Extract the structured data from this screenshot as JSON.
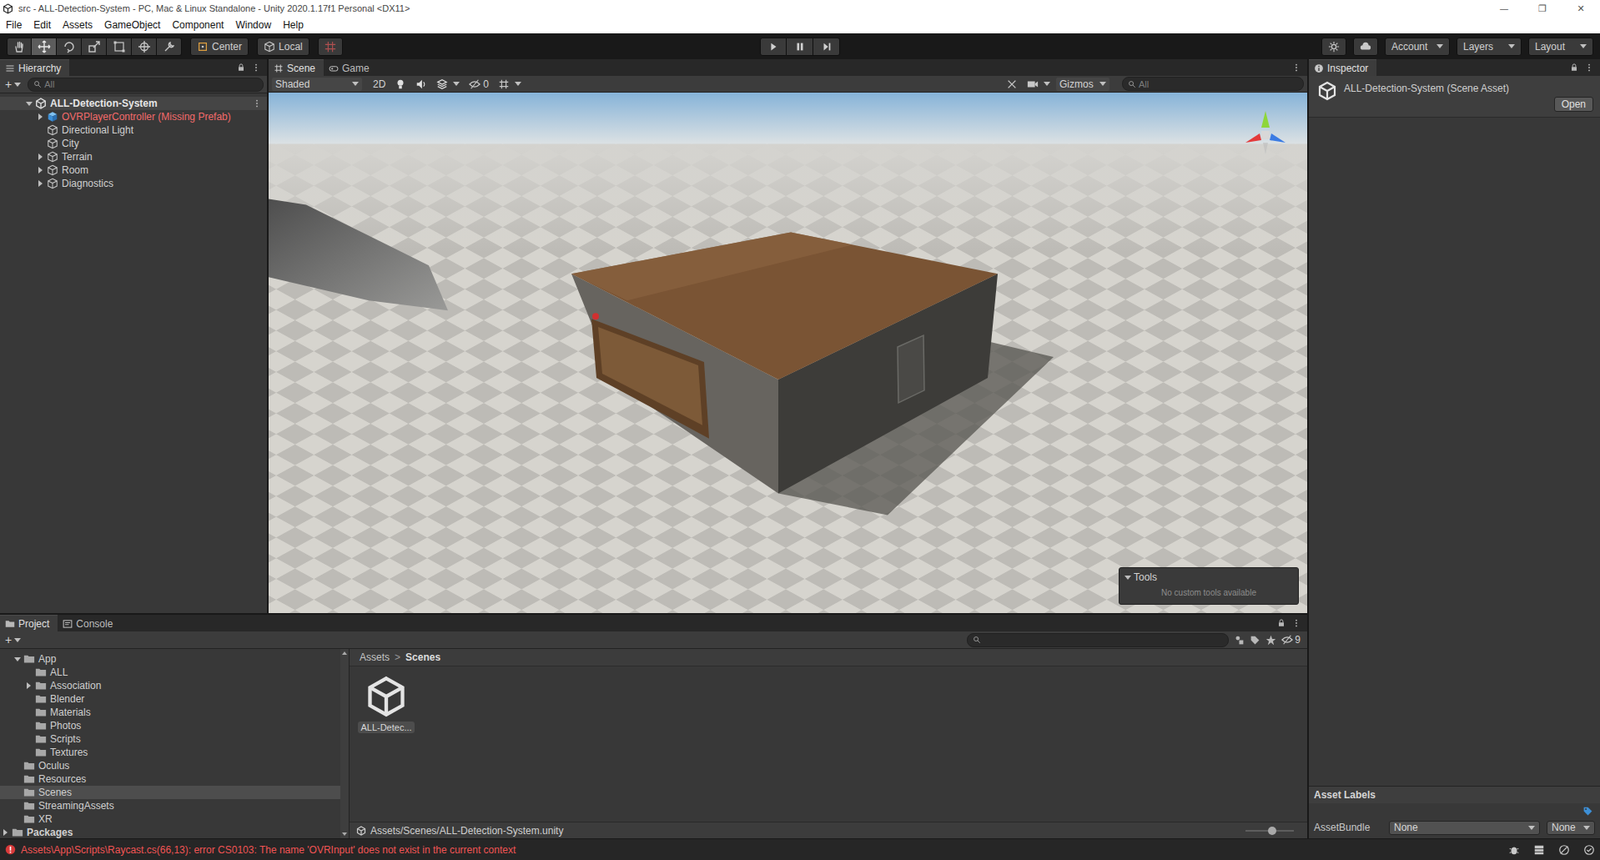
{
  "window": {
    "title": "src - ALL-Detection-System - PC, Mac & Linux Standalone - Unity 2020.1.17f1 Personal <DX11>",
    "controls": [
      "—",
      "❐",
      "✕"
    ]
  },
  "menu": [
    "File",
    "Edit",
    "Assets",
    "GameObject",
    "Component",
    "Window",
    "Help"
  ],
  "toolbar": {
    "tools": [
      {
        "selected": false
      },
      {
        "selected": true
      },
      {
        "selected": false
      },
      {
        "selected": false
      },
      {
        "selected": false
      },
      {
        "selected": false
      },
      {
        "selected": false
      }
    ],
    "pivot": "Center",
    "space": "Local",
    "account": "Account",
    "layers": "Layers",
    "layout": "Layout"
  },
  "hierarchy": {
    "title": "Hierarchy",
    "add": "+",
    "search": {
      "placeholder": "All"
    },
    "scene": {
      "name": "ALL-Detection-System",
      "expanded": true
    },
    "items": [
      {
        "name": "OVRPlayerController (Missing Prefab)",
        "kind": "prefab",
        "expandable": true,
        "expanded": false,
        "missing": true
      },
      {
        "name": "Directional Light",
        "kind": "object",
        "expandable": false,
        "expanded": false,
        "missing": false
      },
      {
        "name": "City",
        "kind": "object",
        "expandable": false,
        "expanded": false,
        "missing": false
      },
      {
        "name": "Terrain",
        "kind": "object",
        "expandable": true,
        "expanded": false,
        "missing": false
      },
      {
        "name": "Room",
        "kind": "object",
        "expandable": true,
        "expanded": false,
        "missing": false
      },
      {
        "name": "Diagnostics",
        "kind": "object",
        "expandable": true,
        "expanded": false,
        "missing": false
      }
    ]
  },
  "scene_view": {
    "tabs": [
      {
        "label": "Scene",
        "selected": true
      },
      {
        "label": "Game",
        "selected": false
      }
    ],
    "shading": "Shaded",
    "mode2d": {
      "label": "2D",
      "on": false
    },
    "hidden_count": "0",
    "gizmos": "Gizmos",
    "search": {
      "placeholder": "All"
    },
    "tools_overlay": {
      "title": "Tools",
      "expanded": true,
      "message": "No custom tools available"
    }
  },
  "inspector": {
    "title": "Inspector",
    "asset": "ALL-Detection-System (Scene Asset)",
    "open_button": "Open",
    "labels_title": "Asset Labels",
    "bundle_label": "AssetBundle",
    "bundle": "None",
    "variant": "None"
  },
  "project": {
    "tabs": [
      {
        "label": "Project",
        "selected": true
      },
      {
        "label": "Console",
        "selected": false
      }
    ],
    "add": "+",
    "hidden_count": "9",
    "tree": [
      {
        "name": "App",
        "expandable": true,
        "expanded": true,
        "selected": false,
        "children": [
          {
            "name": "ALL",
            "expandable": false,
            "expanded": false,
            "selected": false
          },
          {
            "name": "Association",
            "expandable": true,
            "expanded": false,
            "selected": false
          },
          {
            "name": "Blender",
            "expandable": false,
            "expanded": false,
            "selected": false
          },
          {
            "name": "Materials",
            "expandable": false,
            "expanded": false,
            "selected": false
          },
          {
            "name": "Photos",
            "expandable": false,
            "expanded": false,
            "selected": false
          },
          {
            "name": "Scripts",
            "expandable": false,
            "expanded": false,
            "selected": false
          },
          {
            "name": "Textures",
            "expandable": false,
            "expanded": false,
            "selected": false
          }
        ]
      },
      {
        "name": "Oculus",
        "expandable": false,
        "expanded": false,
        "selected": false,
        "children": []
      },
      {
        "name": "Resources",
        "expandable": false,
        "expanded": false,
        "selected": false,
        "children": []
      },
      {
        "name": "Scenes",
        "expandable": false,
        "expanded": false,
        "selected": true,
        "children": []
      },
      {
        "name": "StreamingAssets",
        "expandable": false,
        "expanded": false,
        "selected": false,
        "children": []
      },
      {
        "name": "XR",
        "expandable": false,
        "expanded": false,
        "selected": false,
        "children": []
      }
    ],
    "packages": {
      "name": "Packages",
      "expanded": false
    },
    "breadcrumb": {
      "items": [
        "Assets",
        "Scenes"
      ],
      "separator": ">"
    },
    "assets": [
      {
        "name": "ALL-Detec...",
        "selected": true
      }
    ],
    "path": "Assets/Scenes/ALL-Detection-System.unity",
    "zoom": {
      "level": 0.55
    }
  },
  "status": {
    "level": "error",
    "message": "Assets\\App\\Scripts\\Raycast.cs(66,13): error CS0103: The name 'OVRInput' does not exist in the current context"
  }
}
